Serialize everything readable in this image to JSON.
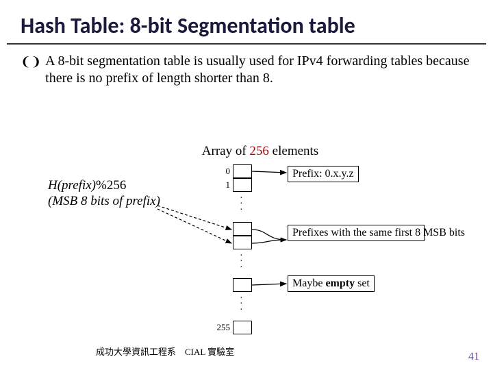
{
  "title": "Hash Table: 8-bit Segmentation table",
  "bullet": "A 8-bit segmentation table is usually used for IPv4 forwarding tables because there is no prefix of length shorter than 8.",
  "array_caption_prefix": "Array of ",
  "array_caption_count": "256",
  "array_caption_suffix": " elements",
  "hash_line1_func": "H",
  "hash_line1_arg": "(prefix)",
  "hash_line1_mod": "%256",
  "hash_line2": "(MSB 8 bits of prefix)",
  "indices": {
    "i0": "0",
    "i1": "1",
    "iLast": "255"
  },
  "annot1": "Prefix: 0.x.y.z",
  "annot2": "Prefixes with the same first 8 MSB bits",
  "annot3_a": "Maybe ",
  "annot3_b": "empty",
  "annot3_c": " set",
  "footer": "成功大學資訊工程系　CIAL 實驗室",
  "slide_number": "41"
}
